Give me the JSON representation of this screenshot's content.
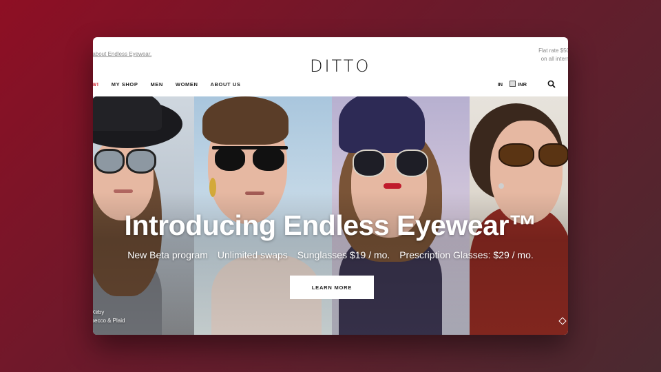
{
  "header": {
    "announcement": "re about Endless Eyewear.",
    "logo": "DITTO",
    "shipping_line1": "Flat rate $50",
    "shipping_line2": "on all intern"
  },
  "nav": {
    "items": [
      {
        "label": "W!",
        "highlight": true
      },
      {
        "label": "MY SHOP"
      },
      {
        "label": "MEN"
      },
      {
        "label": "WOMEN"
      },
      {
        "label": "ABOUT US"
      }
    ],
    "country": "IN",
    "currency": "INR"
  },
  "hero": {
    "headline": "Introducing Endless Eyewear™",
    "sub": [
      "New Beta program",
      "Unlimited swaps",
      "Sunglasses $19 / mo.",
      "Prescription Glasses: $29 / mo."
    ],
    "cta": "LEARN MORE",
    "credit_line1": "Kirby",
    "credit_line2": "secco & Plaid"
  },
  "colors": {
    "accent_red": "#d0202c",
    "background": "#8e0f24"
  }
}
